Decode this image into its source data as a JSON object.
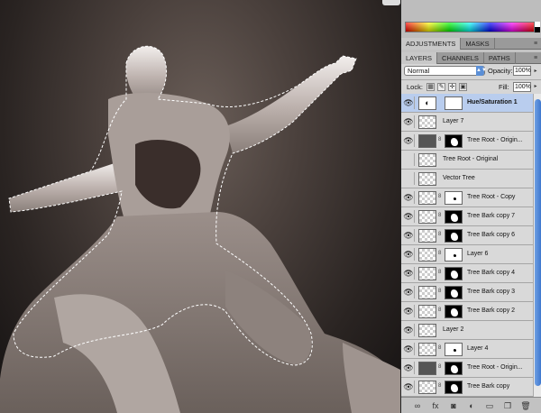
{
  "panels": {
    "adjust_tabs": [
      "ADJUSTMENTS",
      "MASKS"
    ],
    "layer_tabs": [
      "LAYERS",
      "CHANNELS",
      "PATHS"
    ],
    "menu_icon": "≡"
  },
  "layers_panel": {
    "blend_mode": "Normal",
    "opacity_label": "Opacity:",
    "opacity_value": "100%",
    "lock_label": "Lock:",
    "fill_label": "Fill:",
    "fill_value": "100%"
  },
  "layers": [
    {
      "name": "Hue/Saturation 1",
      "visible": true,
      "selected": true,
      "thumb": "adjustment",
      "mask": "white",
      "link": false
    },
    {
      "name": "Layer 7",
      "visible": true,
      "selected": false,
      "thumb": "transparent",
      "mask": null,
      "link": false
    },
    {
      "name": "Tree Root - Origin...",
      "visible": true,
      "selected": false,
      "thumb": "dark",
      "mask": "black",
      "link": true
    },
    {
      "name": "Tree Root - Original",
      "visible": false,
      "selected": false,
      "thumb": "transparent",
      "mask": null,
      "link": false
    },
    {
      "name": "Vector Tree",
      "visible": false,
      "selected": false,
      "thumb": "transparent",
      "mask": null,
      "link": false
    },
    {
      "name": "Tree Root - Copy",
      "visible": true,
      "selected": false,
      "thumb": "transparent",
      "mask": "white",
      "link": true
    },
    {
      "name": "Tree Bark copy 7",
      "visible": true,
      "selected": false,
      "thumb": "transparent",
      "mask": "black",
      "link": true
    },
    {
      "name": "Tree Bark copy 6",
      "visible": true,
      "selected": false,
      "thumb": "transparent",
      "mask": "black",
      "link": true
    },
    {
      "name": "Layer 6",
      "visible": true,
      "selected": false,
      "thumb": "transparent",
      "mask": "white",
      "link": true
    },
    {
      "name": "Tree Bark copy 4",
      "visible": true,
      "selected": false,
      "thumb": "transparent",
      "mask": "black",
      "link": true
    },
    {
      "name": "Tree Bark copy 3",
      "visible": true,
      "selected": false,
      "thumb": "transparent",
      "mask": "black",
      "link": true
    },
    {
      "name": "Tree Bark copy 2",
      "visible": true,
      "selected": false,
      "thumb": "transparent",
      "mask": "black",
      "link": true
    },
    {
      "name": "Layer 2",
      "visible": true,
      "selected": false,
      "thumb": "transparent",
      "mask": null,
      "link": false
    },
    {
      "name": "Layer 4",
      "visible": true,
      "selected": false,
      "thumb": "transparent",
      "mask": "white",
      "link": true
    },
    {
      "name": "Tree Root - Origin...",
      "visible": true,
      "selected": false,
      "thumb": "dark",
      "mask": "black",
      "link": true
    },
    {
      "name": "Tree Bark copy",
      "visible": true,
      "selected": false,
      "thumb": "transparent",
      "mask": "black",
      "link": true
    }
  ],
  "bottom_icons": [
    {
      "name": "link-layers-icon",
      "glyph": "∞"
    },
    {
      "name": "layer-style-icon",
      "glyph": "fx"
    },
    {
      "name": "add-mask-icon",
      "glyph": "◙"
    },
    {
      "name": "adjustment-layer-icon",
      "glyph": "◐"
    },
    {
      "name": "new-group-icon",
      "glyph": "▭"
    },
    {
      "name": "new-layer-icon",
      "glyph": "❐"
    },
    {
      "name": "delete-layer-icon",
      "glyph": "🗑"
    }
  ]
}
